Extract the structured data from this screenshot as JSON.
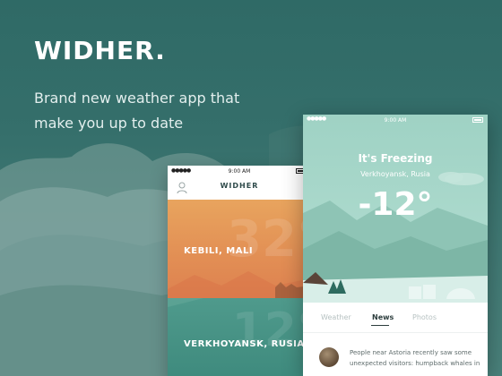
{
  "brand": "WIDHER.",
  "tagline": "Brand new weather app that make you up to date",
  "colors": {
    "background": "#2e6b66",
    "card_warm": "#e28e54",
    "card_teal": "#3e8a7d",
    "hero_mint": "#a9d8cb"
  },
  "phone_list": {
    "status_time": "9:00 AM",
    "app_title": "WIDHER",
    "cards": [
      {
        "big_number": "32°",
        "city": "KEBILI, MALI"
      },
      {
        "big_number": "12°",
        "city": "VERKHOYANSK, RUSIA"
      }
    ]
  },
  "phone_detail": {
    "status_time": "9:00 AM",
    "condition": "It's Freezing",
    "location": "Verkhoyansk, Rusia",
    "temperature": "-12°",
    "tabs": [
      "Weather",
      "News",
      "Photos"
    ],
    "active_tab": "News",
    "news_text": "People near Astoria recently saw some unexpected visitors: humpback whales in"
  }
}
